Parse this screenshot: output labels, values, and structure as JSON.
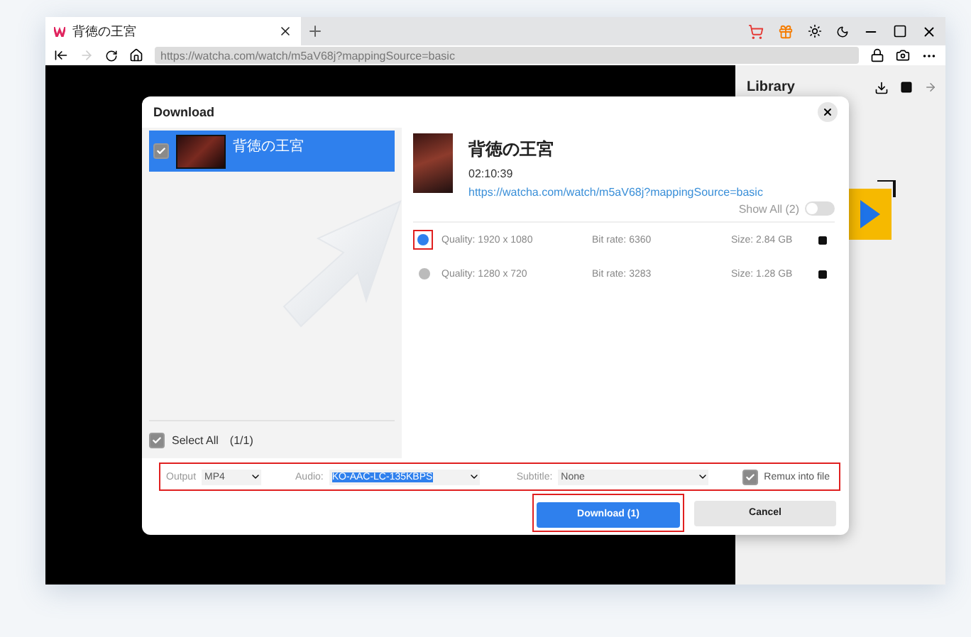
{
  "browser": {
    "tab": {
      "title": "背徳の王宮"
    },
    "url": "https://watcha.com/watch/m5aV68j?mappingSource=basic"
  },
  "library": {
    "title": "Library"
  },
  "dialog": {
    "title": "Download",
    "items": [
      {
        "title": "背徳の王宮",
        "checked": true,
        "selected": true
      }
    ],
    "video": {
      "title": "背徳の王宮",
      "duration": "02:10:39",
      "url": "https://watcha.com/watch/m5aV68j?mappingSource=basic"
    },
    "show_all": {
      "label": "Show All (2)",
      "on": false
    },
    "qualities": [
      {
        "quality": "Quality: 1920 x 1080",
        "bitrate": "Bit rate: 6360",
        "size": "Size: 2.84 GB",
        "selected": true
      },
      {
        "quality": "Quality: 1280 x 720",
        "bitrate": "Bit rate: 3283",
        "size": "Size: 1.28 GB",
        "selected": false
      }
    ],
    "select_all": {
      "label": "Select All",
      "count": "(1/1)",
      "checked": true
    },
    "output": {
      "label": "Output",
      "value": "MP4"
    },
    "audio": {
      "label": "Audio:",
      "value": "KO-AAC-LC-135KBPS"
    },
    "subtitle": {
      "label": "Subtitle:",
      "value": "None"
    },
    "remux": {
      "label": "Remux into file",
      "checked": true
    },
    "download_button": "Download (1)",
    "cancel_button": "Cancel"
  }
}
